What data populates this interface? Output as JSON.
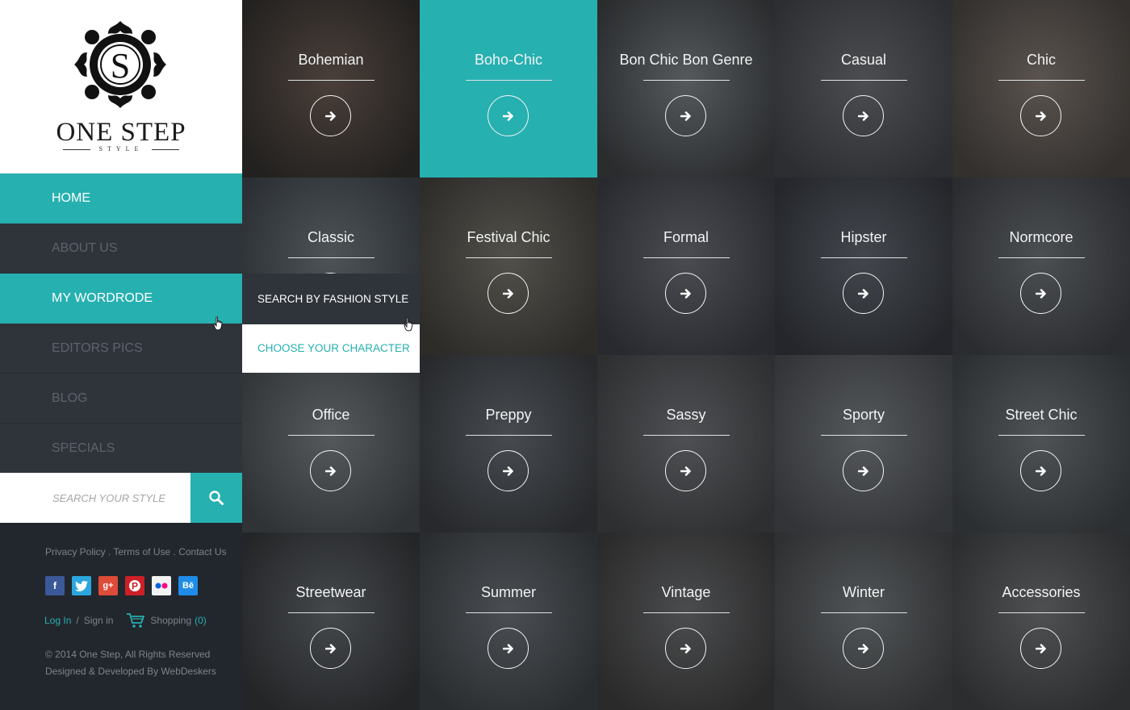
{
  "brand": {
    "name": "ONE STEP",
    "tagline": "STYLE",
    "monogram": "S"
  },
  "nav": [
    {
      "label": "HOME",
      "active": true
    },
    {
      "label": "ABOUT US",
      "active": false
    },
    {
      "label": "MY WORDRODE",
      "active": true
    },
    {
      "label": "EDITORS PICS",
      "active": false
    },
    {
      "label": "BLOG",
      "active": false
    },
    {
      "label": "SPECIALS",
      "active": false
    }
  ],
  "search": {
    "placeholder": "SEARCH YOUR STYLE",
    "button_icon": "search-icon"
  },
  "dropdown": {
    "items": [
      "SEARCH BY FASHION STYLE",
      "CHOOSE YOUR CHARACTER"
    ]
  },
  "footer": {
    "links": [
      "Privacy Policy",
      "Terms of Use",
      "Contact Us"
    ],
    "social": [
      "facebook",
      "twitter",
      "google-plus",
      "pinterest",
      "flickr",
      "behance"
    ],
    "login": "Log In",
    "signin": "Sign in",
    "shopping_label": "Shopping",
    "shopping_count": "(0)",
    "copyright": "© 2014 One Step, All Rights Reserved",
    "credit": "Designed & Developed By WebDeskers"
  },
  "styles": [
    "Bohemian",
    "Boho-Chic",
    "Bon Chic Bon Genre",
    "Casual",
    "Chic",
    "Classic",
    "Festival Chic",
    "Formal",
    "Hipster",
    "Normcore",
    "Office",
    "Preppy",
    "Sassy",
    "Sporty",
    "Street Chic",
    "Streetwear",
    "Summer",
    "Vintage",
    "Winter",
    "Accessories"
  ],
  "highlighted_style": "Boho-Chic",
  "colors": {
    "accent": "#27b0b0",
    "sidebar": "#2b3037",
    "footer": "#22272d"
  }
}
